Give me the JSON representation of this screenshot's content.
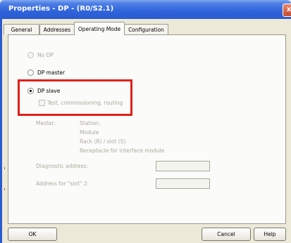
{
  "window": {
    "title": "Properties - DP - (R0/S2.1)",
    "close_label": "x"
  },
  "tabs": [
    {
      "label": "General"
    },
    {
      "label": "Addresses"
    },
    {
      "label": "Operating Mode"
    },
    {
      "label": "Configuration"
    }
  ],
  "mode": {
    "no_dp": "No DP",
    "dp_master": "DP master",
    "dp_slave": "DP slave",
    "test": "Test, commissioning, routing",
    "selected": "DP slave"
  },
  "master": {
    "label": "Master:",
    "station": "Station:",
    "module": "Module",
    "rack": "Rack (R) / slot (S)",
    "receptacle": "Receptacle for interface module"
  },
  "fields": {
    "diag_label": "Diagnostic address:",
    "diag_value": "",
    "slot2_label": "Address for \"slot\" 2:",
    "slot2_value": ""
  },
  "buttons": {
    "ok": "OK",
    "cancel": "Cancel",
    "help": "Help"
  },
  "colors": {
    "highlight": "#e0201a",
    "titlebar": "#2f63db"
  }
}
